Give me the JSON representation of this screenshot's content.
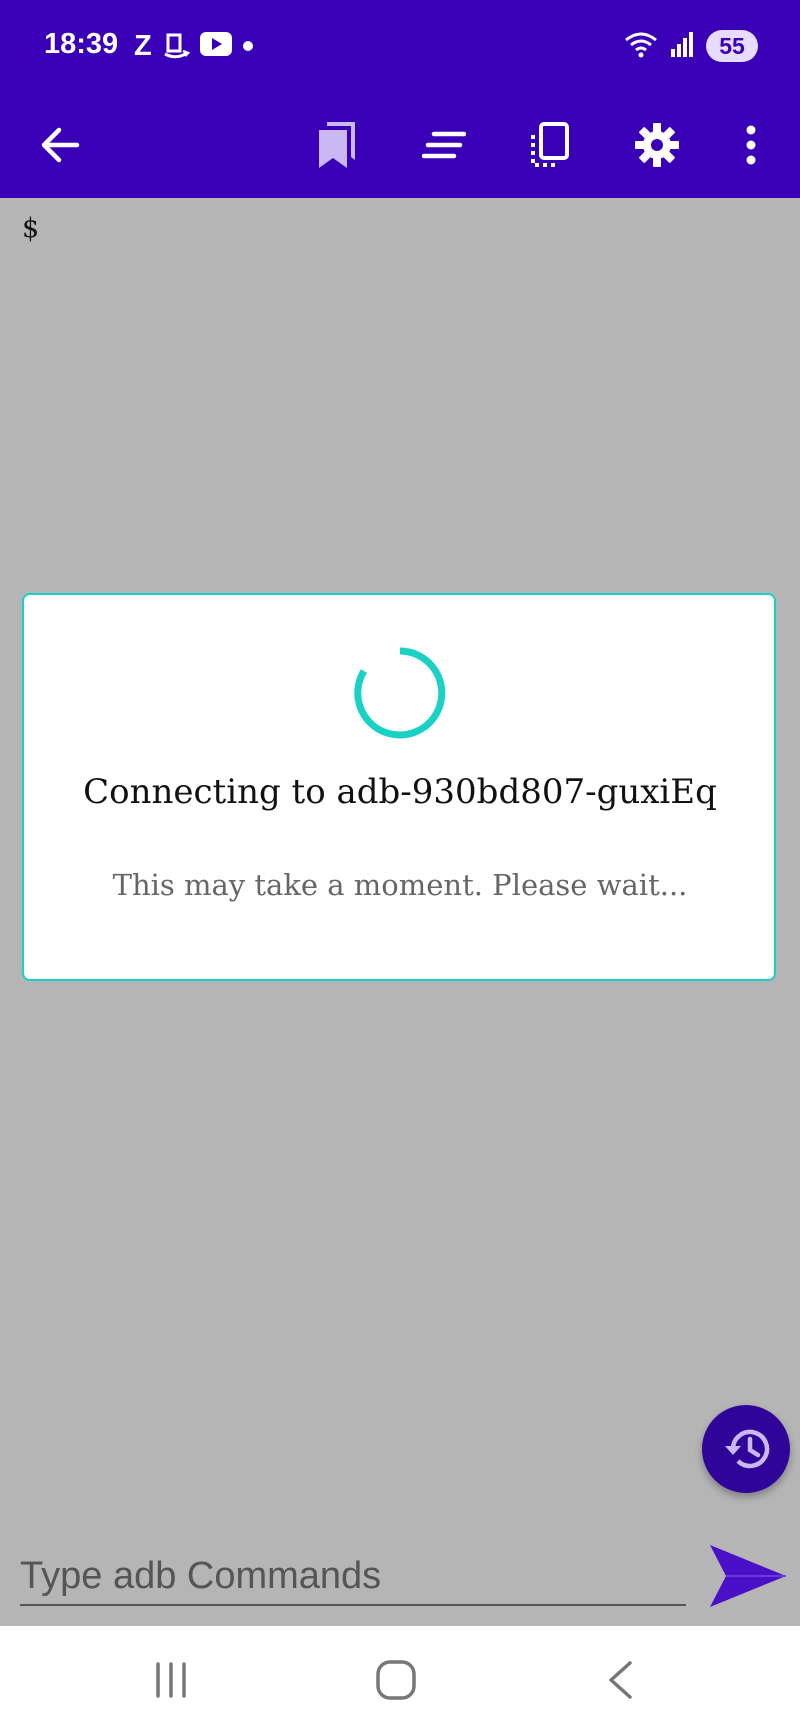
{
  "status_bar": {
    "time": "18:39",
    "notification_icons": [
      "zomato-icon",
      "amazon-icon",
      "youtube-icon",
      "dot-icon"
    ],
    "zomato_letter": "Z",
    "battery": "55"
  },
  "toolbar": {
    "background": "#3a00b8",
    "icons": [
      "back-arrow-icon",
      "bookmarks-icon",
      "text-lines-icon",
      "screenshot-icon",
      "gear-icon",
      "more-vert-icon"
    ]
  },
  "terminal": {
    "prompt": "$"
  },
  "dialog": {
    "title": "Connecting to adb-930bd807-guxiEq",
    "message": "This may take a moment. Please wait...",
    "accent": "#19d1c4"
  },
  "command_bar": {
    "placeholder": "Type adb Commands",
    "value": ""
  },
  "nav_bar": {
    "icons": [
      "recents-icon",
      "home-icon",
      "back-icon"
    ]
  }
}
